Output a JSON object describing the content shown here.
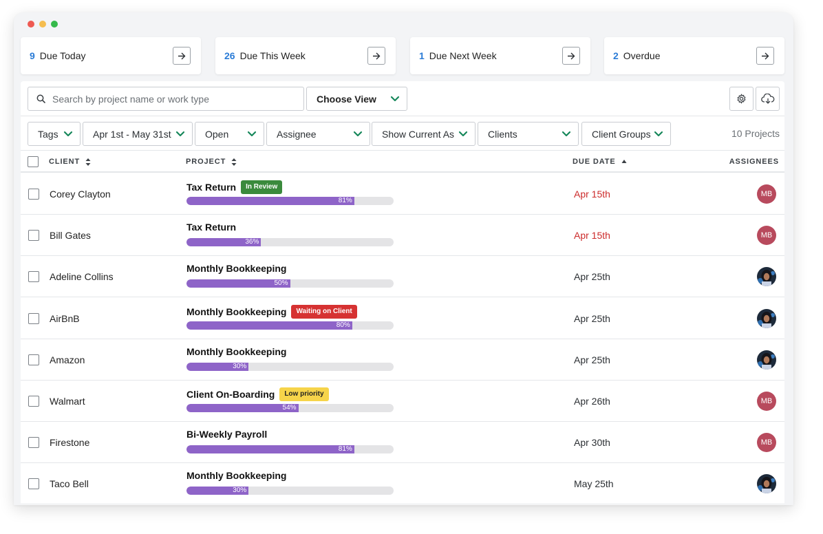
{
  "colors": {
    "accent_blue": "#2a7bd6",
    "chevron_green": "#16875a",
    "progress_purple": "#8e64c8",
    "overdue_red": "#cc2a2a",
    "avatar_mb": "#b84a5d",
    "traffic_red": "#ee5a52",
    "traffic_yellow": "#f5bd4f",
    "traffic_green": "#35b94b"
  },
  "summary": [
    {
      "count": "9",
      "label": "Due Today",
      "icon": "arrow-right-icon"
    },
    {
      "count": "26",
      "label": "Due This Week",
      "icon": "arrow-right-icon"
    },
    {
      "count": "1",
      "label": "Due Next Week",
      "icon": "arrow-right-icon"
    },
    {
      "count": "2",
      "label": "Overdue",
      "icon": "arrow-right-icon"
    }
  ],
  "toolbar": {
    "search_placeholder": "Search by project name or work type",
    "choose_view": "Choose View",
    "settings_icon": "gear-icon",
    "download_icon": "cloud-download-icon"
  },
  "filters": [
    {
      "label": "Tags"
    },
    {
      "label": "Apr 1st - May 31st"
    },
    {
      "label": "Open"
    },
    {
      "label": "Assignee"
    },
    {
      "label": "Show Current As"
    },
    {
      "label": "Clients"
    },
    {
      "label": "Client Groups"
    }
  ],
  "projects_count": "10 Projects",
  "table": {
    "headers": {
      "client": "CLIENT",
      "project": "PROJECT",
      "due_date": "DUE DATE",
      "assignees": "ASSIGNEES"
    },
    "rows": [
      {
        "client": "Corey Clayton",
        "project": "Tax Return",
        "badge": "In Review",
        "badge_type": "review",
        "progress": 81,
        "progress_label": "81%",
        "due": "Apr 15th",
        "overdue": true,
        "assignee": "MB",
        "assignee_type": "initials"
      },
      {
        "client": "Bill Gates",
        "project": "Tax Return",
        "badge": "",
        "badge_type": "",
        "progress": 36,
        "progress_label": "36%",
        "due": "Apr 15th",
        "overdue": true,
        "assignee": "MB",
        "assignee_type": "initials"
      },
      {
        "client": "Adeline Collins",
        "project": "Monthly Bookkeeping",
        "badge": "",
        "badge_type": "",
        "progress": 50,
        "progress_label": "50%",
        "due": "Apr 25th",
        "overdue": false,
        "assignee": "",
        "assignee_type": "photo"
      },
      {
        "client": "AirBnB",
        "project": "Monthly Bookkeeping",
        "badge": "Waiting on Client",
        "badge_type": "waiting",
        "progress": 80,
        "progress_label": "80%",
        "due": "Apr 25th",
        "overdue": false,
        "assignee": "",
        "assignee_type": "photo"
      },
      {
        "client": "Amazon",
        "project": "Monthly Bookkeeping",
        "badge": "",
        "badge_type": "",
        "progress": 30,
        "progress_label": "30%",
        "due": "Apr 25th",
        "overdue": false,
        "assignee": "",
        "assignee_type": "photo"
      },
      {
        "client": "Walmart",
        "project": "Client On-Boarding",
        "badge": "Low priority",
        "badge_type": "low",
        "progress": 54,
        "progress_label": "54%",
        "due": "Apr 26th",
        "overdue": false,
        "assignee": "MB",
        "assignee_type": "initials"
      },
      {
        "client": "Firestone",
        "project": "Bi-Weekly Payroll",
        "badge": "",
        "badge_type": "",
        "progress": 81,
        "progress_label": "81%",
        "due": "Apr 30th",
        "overdue": false,
        "assignee": "MB",
        "assignee_type": "initials"
      },
      {
        "client": "Taco Bell",
        "project": "Monthly Bookkeeping",
        "badge": "",
        "badge_type": "",
        "progress": 30,
        "progress_label": "30%",
        "due": "May 25th",
        "overdue": false,
        "assignee": "",
        "assignee_type": "photo"
      }
    ]
  }
}
